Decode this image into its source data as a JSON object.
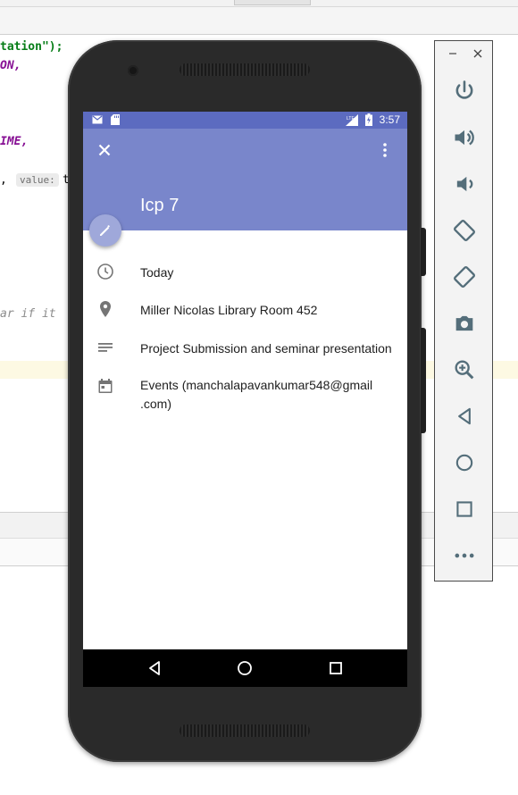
{
  "ide": {
    "code_lines": {
      "line1": "tation\");",
      "line2": "ON,",
      "line3": "IME,",
      "line4_prefix": ",",
      "line4_hint": "value:",
      "line4_suffix": "t",
      "line5": "ar if it"
    }
  },
  "emulator_toolbar": {
    "minimize_label": "−",
    "close_label": "×",
    "buttons": [
      {
        "name": "power",
        "icon": "power-icon"
      },
      {
        "name": "volume-up",
        "icon": "volume-up-icon"
      },
      {
        "name": "volume-down",
        "icon": "volume-down-icon"
      },
      {
        "name": "rotate-left",
        "icon": "rotate-left-icon"
      },
      {
        "name": "rotate-right",
        "icon": "rotate-right-icon"
      },
      {
        "name": "screenshot",
        "icon": "camera-icon"
      },
      {
        "name": "zoom",
        "icon": "zoom-in-icon"
      },
      {
        "name": "back",
        "icon": "back-icon"
      },
      {
        "name": "home",
        "icon": "home-icon"
      },
      {
        "name": "overview",
        "icon": "overview-icon"
      },
      {
        "name": "more",
        "icon": "more-icon"
      }
    ]
  },
  "phone": {
    "status_bar": {
      "time": "3:57",
      "icons": [
        "gmail-icon",
        "sd-card-icon",
        "signal-lte-icon",
        "battery-charging-icon"
      ]
    },
    "event": {
      "title": "Icp 7",
      "header_color": "#7986cb",
      "status_color": "#5c6bc0",
      "details": [
        {
          "icon": "clock-icon",
          "text": "Today"
        },
        {
          "icon": "location-pin-icon",
          "text": "Miller Nicolas Library Room 452"
        },
        {
          "icon": "description-icon",
          "text": "Project Submission and seminar presentation"
        },
        {
          "icon": "calendar-icon",
          "text": "Events (manchalapavankumar548@gmail .com)"
        }
      ]
    },
    "nav_bar": {
      "icons": [
        "back-icon",
        "home-icon",
        "recents-icon"
      ]
    }
  }
}
